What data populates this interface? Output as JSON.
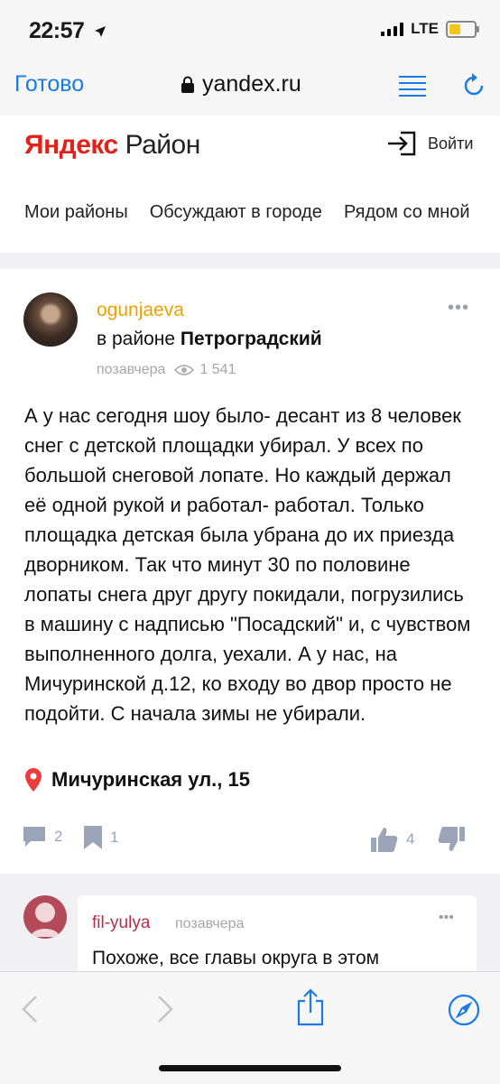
{
  "status_bar": {
    "time": "22:57",
    "network": "LTE",
    "location_arrow": "location-arrow-icon"
  },
  "safari": {
    "done_label": "Готово",
    "url": "yandex.ru"
  },
  "header": {
    "logo_brand": "Яндекс",
    "logo_product": "Район",
    "login_label": "Войти",
    "tabs": [
      "Мои районы",
      "Обсуждают в городе",
      "Рядом со мной"
    ]
  },
  "post": {
    "author": "ogunjaeva",
    "district_prefix": "в районе",
    "district_name": "Петроградский",
    "time": "позавчера",
    "views": "1 541",
    "text": "А у нас сегодня шоу было- десант из 8 человек снег с детской площадки убирал. У всех по большой снеговой лопате. Но каждый держал её одной рукой и работал- работал. Только площадка детская была убрана до их приезда дворником. Так что минут 30 по половине лопаты снега друг другу покидали, погрузились в машину с надписью \"Посадский\" и, с чувством выполненного долга, уехали. А у нас, на Мичуринской д.12, ко входу во двор просто не подойти. С начала зимы не убирали.",
    "location": "Мичуринская ул., 15",
    "comments_count": "2",
    "bookmarks_count": "1",
    "likes_count": "4"
  },
  "comment": {
    "author": "fil-yulya",
    "time": "позавчера",
    "text": "Похоже, все главы округа в этом"
  },
  "colors": {
    "accent_blue": "#1a7ae6",
    "yandex_red": "#e0221b",
    "author_orange": "#f0a000",
    "comment_author": "#b3304a",
    "icon_gray": "#9aa6b8"
  }
}
